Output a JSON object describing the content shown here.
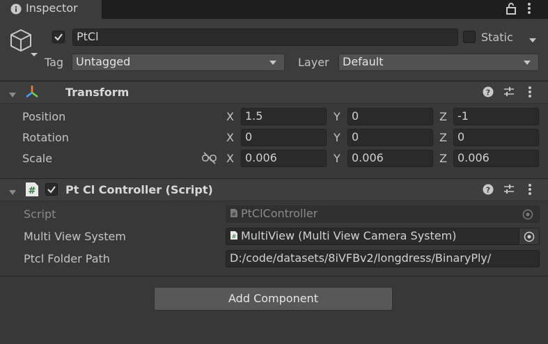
{
  "tab": {
    "title": "Inspector",
    "icon": "info-icon"
  },
  "object": {
    "name": "PtCl",
    "active": true,
    "static_label": "Static",
    "tag_label": "Tag",
    "tag_value": "Untagged",
    "layer_label": "Layer",
    "layer_value": "Default"
  },
  "transform": {
    "title": "Transform",
    "rows": [
      {
        "label": "Position",
        "x": "1.5",
        "y": "0",
        "z": "-1"
      },
      {
        "label": "Rotation",
        "x": "0",
        "y": "0",
        "z": "0"
      },
      {
        "label": "Scale",
        "x": "0.006",
        "y": "0.006",
        "z": "0.006"
      }
    ],
    "axis_x": "X",
    "axis_y": "Y",
    "axis_z": "Z"
  },
  "script": {
    "title": "Pt Cl Controller (Script)",
    "enabled": true,
    "rows": [
      {
        "label": "Script",
        "value": "PtClController"
      },
      {
        "label": "Multi View System",
        "value": "MultiView (Multi View Camera System)"
      },
      {
        "label": "Ptcl Folder Path",
        "value": "D:/code/datasets/8iVFBv2/longdress/BinaryPly/"
      }
    ]
  },
  "add_component_label": "Add Component",
  "colors": {
    "background": "#383838",
    "field": "#2a2a2a",
    "header": "#3e3e3e",
    "button": "#585858"
  }
}
